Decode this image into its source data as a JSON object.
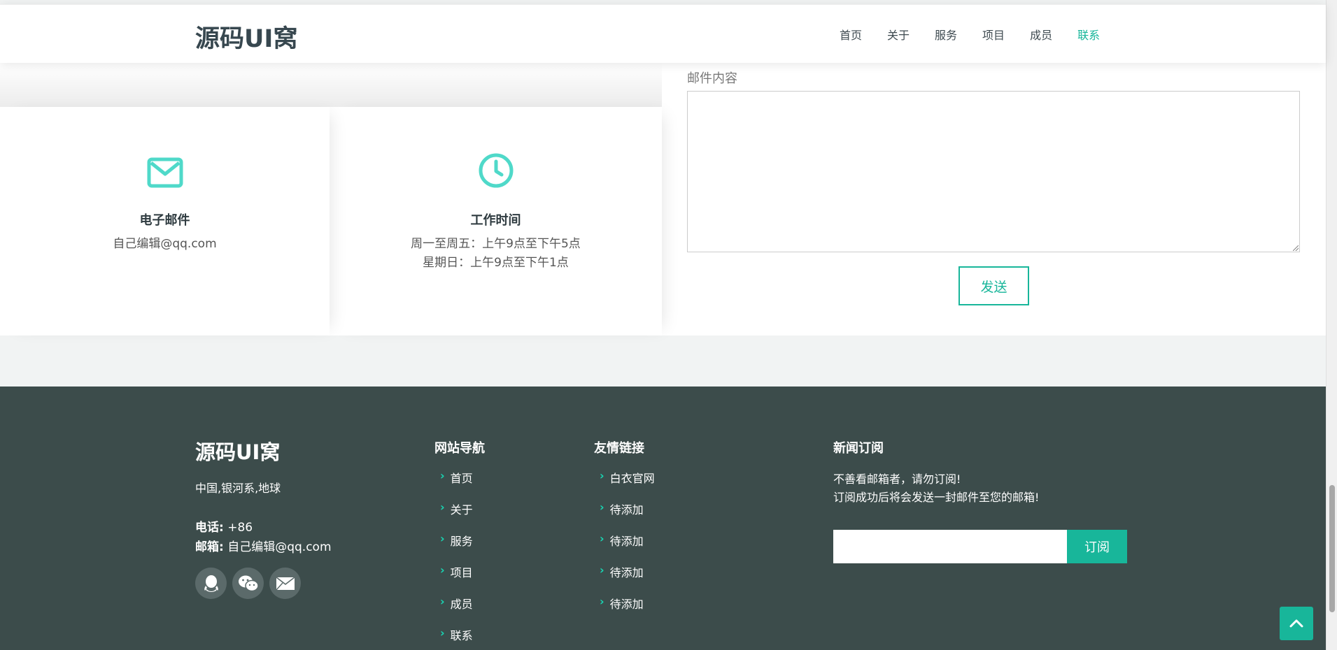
{
  "header": {
    "logo": "源码UI窝",
    "nav": [
      {
        "label": "首页",
        "active": false
      },
      {
        "label": "关于",
        "active": false
      },
      {
        "label": "服务",
        "active": false
      },
      {
        "label": "项目",
        "active": false
      },
      {
        "label": "成员",
        "active": false
      },
      {
        "label": "联系",
        "active": true
      }
    ]
  },
  "contact": {
    "email_box": {
      "icon": "envelope-icon",
      "title": "电子邮件",
      "text": "自己编辑@qq.com"
    },
    "hours_box": {
      "icon": "clock-icon",
      "title": "工作时间",
      "line1": "周一至周五：上午9点至下午5点",
      "line2": "星期日：上午9点至下午1点"
    },
    "form": {
      "content_label": "邮件内容",
      "content_value": "",
      "send_label": "发送"
    }
  },
  "footer": {
    "brand": "源码UI窝",
    "address": "中国,银河系,地球",
    "phone_label": "电话:",
    "phone_value": "+86",
    "email_label": "邮箱:",
    "email_value": "自己编辑@qq.com",
    "social": [
      "qq-icon",
      "wechat-icon",
      "mail-icon"
    ],
    "nav_title": "网站导航",
    "nav_links": [
      "首页",
      "关于",
      "服务",
      "项目",
      "成员",
      "联系"
    ],
    "friend_title": "友情链接",
    "friend_links": [
      "白衣官网",
      "待添加",
      "待添加",
      "待添加",
      "待添加"
    ],
    "news_title": "新闻订阅",
    "news_line1": "不善看邮箱者，请勿订阅!",
    "news_line2": "订阅成功后将会发送一封邮件至您的邮箱!",
    "subscribe_value": "",
    "subscribe_label": "订阅"
  },
  "colors": {
    "accent": "#18b69a",
    "footer_bg": "#3c4c4b",
    "icon_teal": "#4fd9c9"
  }
}
